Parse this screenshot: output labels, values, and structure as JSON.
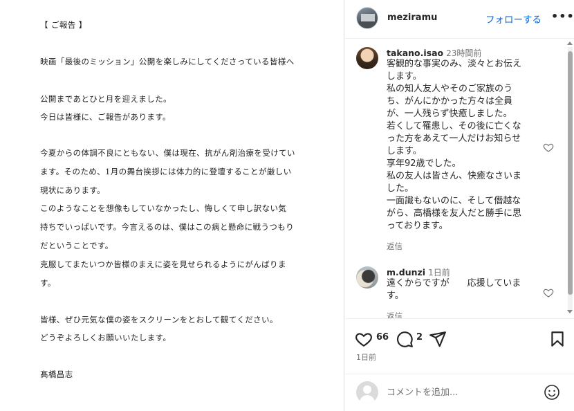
{
  "letter": {
    "lines": [
      "【 ご報告 】",
      "映画「最後のミッション」公開を楽しみにしてくださっている皆様へ",
      "公開まであとひと月を迎えました。",
      "今日は皆様に、ご報告があります。",
      "今夏からの体調不良にともない、僕は現在、抗がん剤治療を受けてい",
      "ます。そのため、1月の舞台挨拶には体力的に登壇することが厳しい",
      "現状にあります。",
      "このようなことを想像もしていなかったし、悔しくて申し訳ない気",
      "持ちでいっぱいです。今言えるのは、僕はこの病と懸命に戦うつもり",
      "だということです。",
      "克服してまたいつか皆様のまえに姿を見せられるようにがんばりま",
      "す。",
      "皆様、ぜひ元気な僕の姿をスクリーンをとおして観てください。",
      "どうぞよろしくお願いいたします。",
      "髙橋昌志"
    ]
  },
  "header": {
    "username": "meziramu",
    "follow_label": "フォローする",
    "more_label": "•••"
  },
  "comments": [
    {
      "username": "takano.isao",
      "time": "23時間前",
      "text": "客観的な事実のみ、淡々とお伝え\nします。\n私の知人友人やそのご家族のう\nち、がんにかかった方々は全員\nが、一人残らず快癒しました。\n若くして罹患し、その後に亡くな\nった方をあえて一人だけお知らせ\nします。\n享年92歳でした。\n私の友人は皆さん、快癒なさいま\nした。\n一面識もないのに、そして僭越な\nがら、高橋様を友人だと勝手に思\nっております。",
      "reply_label": "返信"
    },
    {
      "username": "m.dunzi",
      "time": "1日前",
      "text": "遠くからですが　　応援していま\nす。",
      "reply_label": "返信"
    }
  ],
  "actions": {
    "likes": "66",
    "comments": "2",
    "date": "1日前"
  },
  "add_comment": {
    "placeholder": "コメントを追加..."
  },
  "colors": {
    "follow": "#0064e0",
    "muted": "#737373",
    "text": "#262626"
  }
}
